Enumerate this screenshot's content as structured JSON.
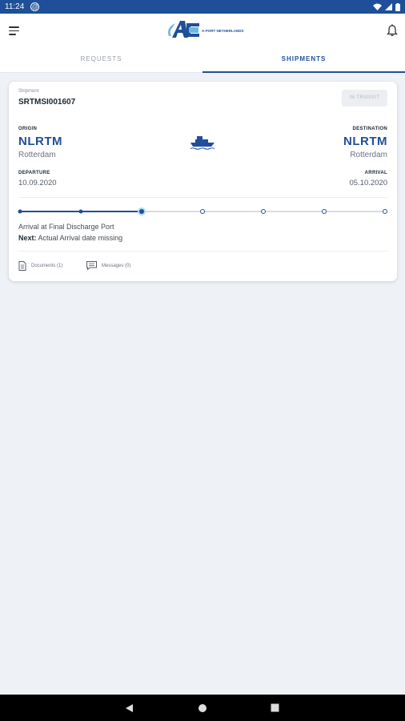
{
  "status_bar": {
    "time": "11:24",
    "notification_icon": "at-sign-icon",
    "icons": [
      "wifi-icon",
      "signal-icon",
      "battery-icon"
    ]
  },
  "header": {
    "menu_icon": "hamburger-menu-icon",
    "logo_text": "A-PORT NETHERLANDS",
    "notification_icon": "bell-icon"
  },
  "tabs": [
    {
      "label": "REQUESTS",
      "active": false
    },
    {
      "label": "SHIPMENTS",
      "active": true
    }
  ],
  "shipment": {
    "label": "Shipment",
    "id": "SRTMSI001607",
    "status": "IN TRANSIT",
    "origin": {
      "label": "ORIGIN",
      "code": "NLRTM",
      "city": "Rotterdam"
    },
    "destination": {
      "label": "DESTINATION",
      "code": "NLRTM",
      "city": "Rotterdam"
    },
    "departure": {
      "label": "DEPARTURE",
      "date": "10.09.2020"
    },
    "arrival": {
      "label": "ARRIVAL",
      "date": "05.10.2020"
    },
    "transport_icon": "ship-icon",
    "progress": {
      "steps_total": 7,
      "current_step": 3
    },
    "status_text": "Arrival at Final Discharge Port",
    "next_label": "Next:",
    "next_text": "Actual Arrival date missing",
    "documents": {
      "label": "Documents (1)",
      "icon": "document-icon"
    },
    "messages": {
      "label": "Messages (0)",
      "icon": "message-icon"
    }
  },
  "colors": {
    "primary": "#1f4f99",
    "accent": "#a9dcf3",
    "background": "#eef1f5"
  },
  "nav_bar": {
    "buttons": [
      "back-icon",
      "home-icon",
      "recents-icon"
    ]
  }
}
